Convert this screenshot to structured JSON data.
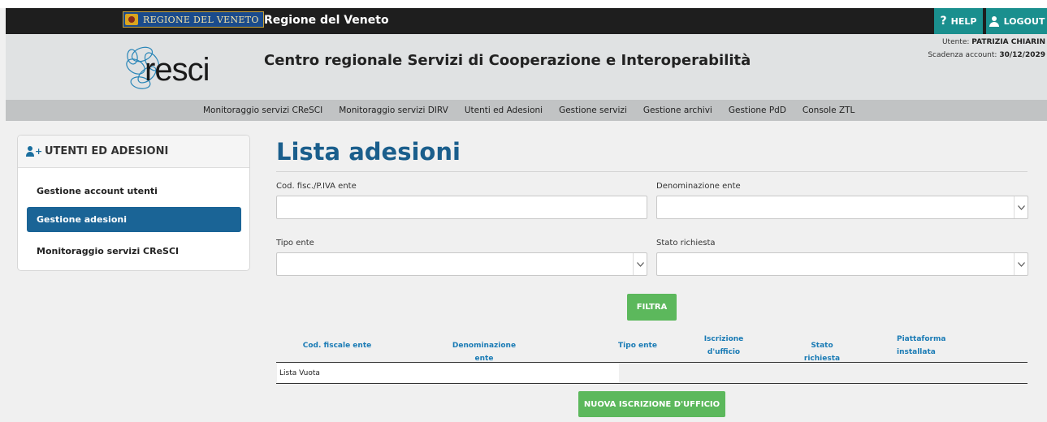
{
  "topbar": {
    "logo_text": "REGIONE DEL VENETO",
    "title": "Regione del Veneto",
    "help_label": "HELP",
    "logout_label": "LOGOUT",
    "accent": "#1a8f8e"
  },
  "header": {
    "logo_word": "resci",
    "title": "Centro regionale Servizi di Cooperazione e Interoperabilità",
    "user_label": "Utente:",
    "user_name": "PATRIZIA CHIARIN",
    "expiry_label": "Scadenza account:",
    "expiry_date": "30/12/2029"
  },
  "nav": {
    "items": [
      "Monitoraggio servizi CReSCI",
      "Monitoraggio servizi DIRV",
      "Utenti ed Adesioni",
      "Gestione servizi",
      "Gestione archivi",
      "Gestione PdD",
      "Console ZTL"
    ]
  },
  "sidebar": {
    "title": "UTENTI ED ADESIONI",
    "items": [
      {
        "label": "Gestione account utenti",
        "active": false
      },
      {
        "label": "Gestione adesioni",
        "active": true
      },
      {
        "label": "Monitoraggio servizi CReSCI",
        "active": false
      }
    ]
  },
  "main": {
    "title": "Lista adesioni",
    "filters": {
      "codfisc_label": "Cod. fisc./P.IVA ente",
      "codfisc_value": "",
      "denominazione_label": "Denominazione ente",
      "denominazione_value": "",
      "tipo_label": "Tipo ente",
      "tipo_value": "",
      "stato_label": "Stato richiesta",
      "stato_value": ""
    },
    "filter_button": "FILTRA",
    "table": {
      "columns": {
        "c1": "Cod. fiscale ente",
        "c2": "Denominazione ente",
        "c3": "Tipo ente",
        "c4a": "Iscrizione",
        "c4b": "d'ufficio",
        "c5": "Stato richiesta",
        "c6a": "Piattaforma",
        "c6b": "installata"
      },
      "empty_text": "Lista Vuota"
    },
    "new_button": "NUOVA ISCRIZIONE D'UFFICIO"
  }
}
